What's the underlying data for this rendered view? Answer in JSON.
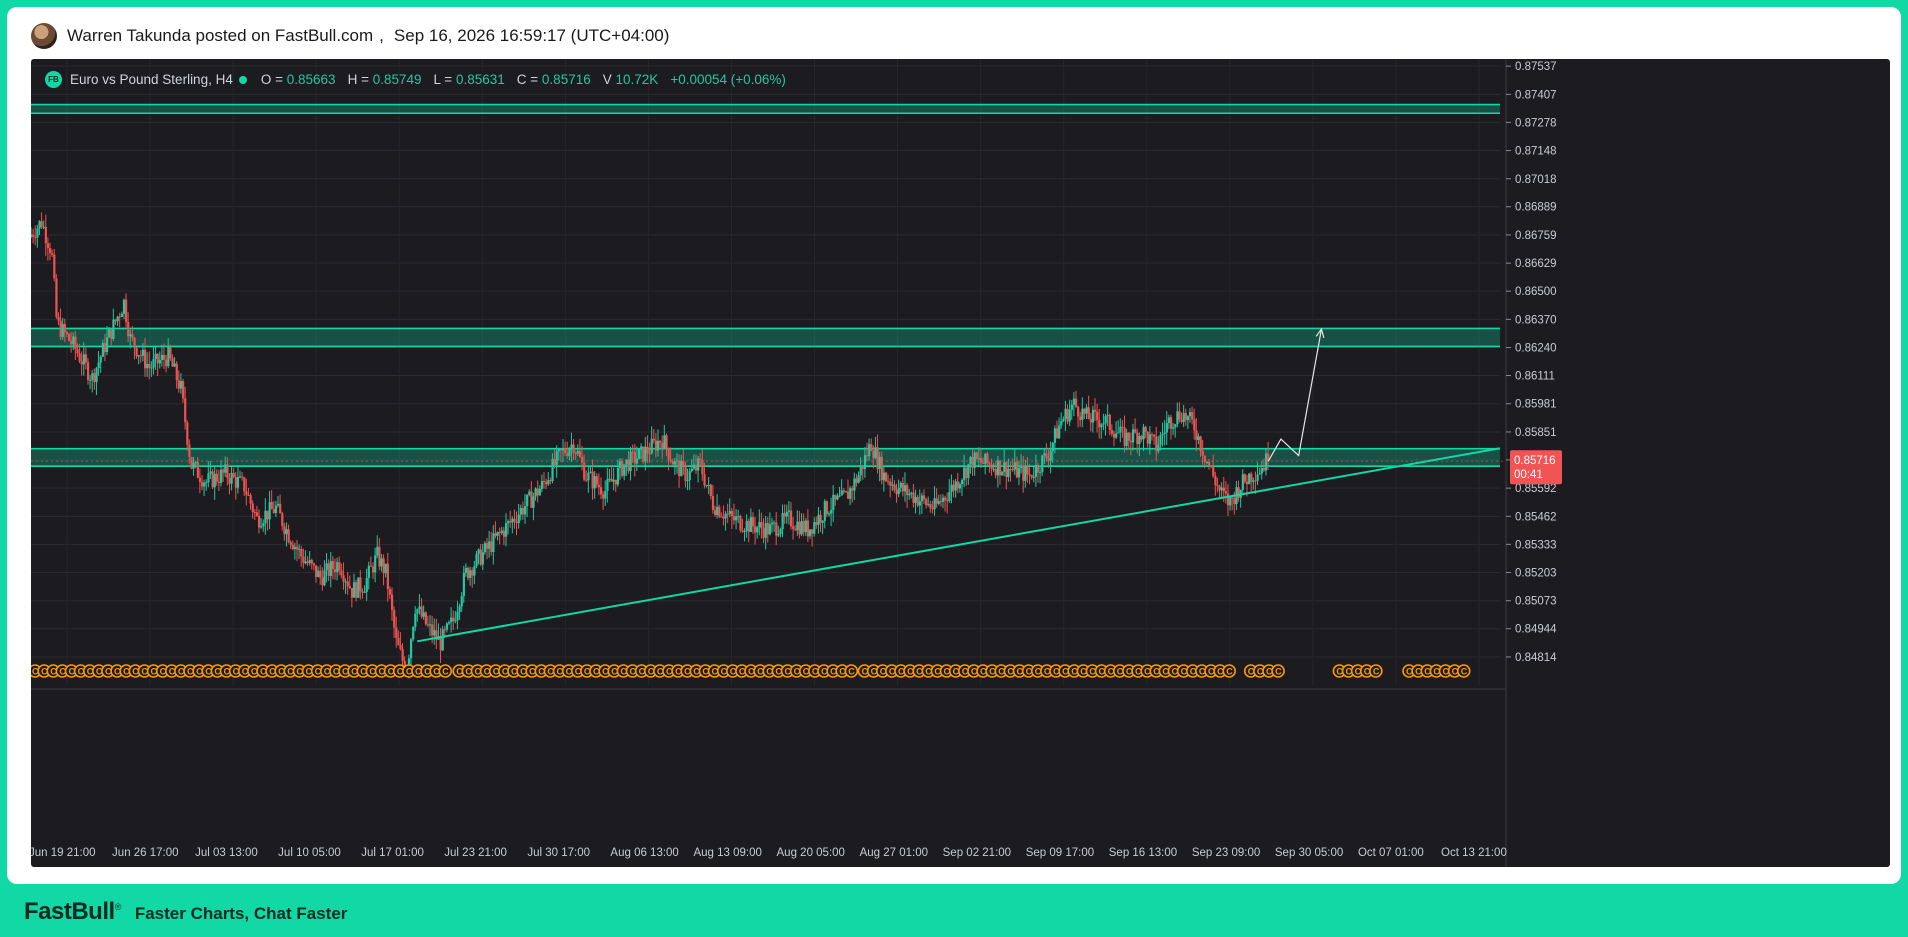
{
  "post": {
    "author_line": "Warren Takunda posted on FastBull.com",
    "separator": ",",
    "datetime": "Sep 16, 2026 16:59:17 (UTC+04:00)"
  },
  "legend": {
    "badge": "FB",
    "symbol": "Euro vs Pound Sterling, H4",
    "open_label": "O =",
    "open": "0.85663",
    "high_label": "H =",
    "high": "0.85749",
    "low_label": "L =",
    "low": "0.85631",
    "close_label": "C =",
    "close": "0.85716",
    "volume_label": "V",
    "volume": "10.72K",
    "change": "+0.00054 (+0.06%)"
  },
  "price_tag": {
    "price": "0.85716",
    "countdown": "00:41"
  },
  "footer": {
    "brand": "FastBull",
    "trademark": "®",
    "tagline": "Faster Charts, Chat Faster"
  },
  "colors": {
    "up": "#26c6a0",
    "down": "#ef5350",
    "zone": "#11d8a5",
    "event": "#ff9800",
    "background": "#1c1c20"
  },
  "chart_data": {
    "type": "candlestick",
    "timeframe": "H4",
    "ylim": [
      0.8468,
      0.8757
    ],
    "y_ticks": [
      "0.87537",
      "0.87407",
      "0.87278",
      "0.87148",
      "0.87018",
      "0.86889",
      "0.86759",
      "0.86629",
      "0.86500",
      "0.86370",
      "0.86240",
      "0.86111",
      "0.85981",
      "0.85851",
      "0.85722",
      "0.85592",
      "0.85462",
      "0.85333",
      "0.85203",
      "0.85073",
      "0.84944",
      "0.84814"
    ],
    "x_ticks": [
      "Jun 19 21:00",
      "Jun 26 17:00",
      "Jul 03 13:00",
      "Jul 10 05:00",
      "Jul 17 01:00",
      "Jul 23 21:00",
      "Jul 30 17:00",
      "Aug 06 13:00",
      "Aug 13 09:00",
      "Aug 20 05:00",
      "Aug 27 01:00",
      "Sep 02 21:00",
      "Sep 09 17:00",
      "Sep 16 13:00",
      "Sep 23 09:00",
      "Sep 30 05:00",
      "Oct 07 01:00",
      "Oct 13 21:00"
    ],
    "x_range_days": [
      0,
      116
    ],
    "last_price": 0.85716,
    "price_path": [
      {
        "t": 0.0,
        "p": 0.8675
      },
      {
        "t": 1.0,
        "p": 0.8682
      },
      {
        "t": 1.8,
        "p": 0.8668
      },
      {
        "t": 2.2,
        "p": 0.8635
      },
      {
        "t": 3.5,
        "p": 0.8625
      },
      {
        "t": 5.0,
        "p": 0.861
      },
      {
        "t": 6.0,
        "p": 0.8625
      },
      {
        "t": 7.5,
        "p": 0.8645
      },
      {
        "t": 8.0,
        "p": 0.8628
      },
      {
        "t": 9.5,
        "p": 0.8615
      },
      {
        "t": 11.0,
        "p": 0.862
      },
      {
        "t": 12.0,
        "p": 0.8605
      },
      {
        "t": 12.8,
        "p": 0.857
      },
      {
        "t": 14.0,
        "p": 0.8562
      },
      {
        "t": 15.5,
        "p": 0.8566
      },
      {
        "t": 17.0,
        "p": 0.856
      },
      {
        "t": 18.0,
        "p": 0.8545
      },
      {
        "t": 19.5,
        "p": 0.855
      },
      {
        "t": 20.5,
        "p": 0.8538
      },
      {
        "t": 21.5,
        "p": 0.8528
      },
      {
        "t": 23.0,
        "p": 0.8518
      },
      {
        "t": 24.5,
        "p": 0.8525
      },
      {
        "t": 25.5,
        "p": 0.8512
      },
      {
        "t": 26.5,
        "p": 0.8515
      },
      {
        "t": 27.5,
        "p": 0.8528
      },
      {
        "t": 28.2,
        "p": 0.852
      },
      {
        "t": 29.0,
        "p": 0.8488
      },
      {
        "t": 29.8,
        "p": 0.8475
      },
      {
        "t": 30.5,
        "p": 0.8505
      },
      {
        "t": 31.5,
        "p": 0.8495
      },
      {
        "t": 32.5,
        "p": 0.8488
      },
      {
        "t": 33.5,
        "p": 0.8498
      },
      {
        "t": 34.5,
        "p": 0.852
      },
      {
        "t": 36.0,
        "p": 0.853
      },
      {
        "t": 37.5,
        "p": 0.854
      },
      {
        "t": 39.0,
        "p": 0.855
      },
      {
        "t": 40.5,
        "p": 0.856
      },
      {
        "t": 42.0,
        "p": 0.8575
      },
      {
        "t": 43.0,
        "p": 0.858
      },
      {
        "t": 44.0,
        "p": 0.8565
      },
      {
        "t": 45.5,
        "p": 0.8558
      },
      {
        "t": 47.0,
        "p": 0.857
      },
      {
        "t": 48.5,
        "p": 0.8575
      },
      {
        "t": 50.0,
        "p": 0.8582
      },
      {
        "t": 51.0,
        "p": 0.857
      },
      {
        "t": 52.0,
        "p": 0.8565
      },
      {
        "t": 53.0,
        "p": 0.857
      },
      {
        "t": 54.0,
        "p": 0.8552
      },
      {
        "t": 55.5,
        "p": 0.8545
      },
      {
        "t": 57.0,
        "p": 0.8542
      },
      {
        "t": 58.5,
        "p": 0.854
      },
      {
        "t": 60.0,
        "p": 0.8545
      },
      {
        "t": 61.5,
        "p": 0.854
      },
      {
        "t": 63.0,
        "p": 0.855
      },
      {
        "t": 64.5,
        "p": 0.8555
      },
      {
        "t": 65.5,
        "p": 0.8565
      },
      {
        "t": 66.5,
        "p": 0.858
      },
      {
        "t": 67.5,
        "p": 0.8565
      },
      {
        "t": 68.5,
        "p": 0.856
      },
      {
        "t": 70.0,
        "p": 0.8555
      },
      {
        "t": 71.5,
        "p": 0.855
      },
      {
        "t": 73.0,
        "p": 0.856
      },
      {
        "t": 74.5,
        "p": 0.8572
      },
      {
        "t": 76.0,
        "p": 0.857
      },
      {
        "t": 77.5,
        "p": 0.8568
      },
      {
        "t": 79.0,
        "p": 0.8565
      },
      {
        "t": 80.5,
        "p": 0.8575
      },
      {
        "t": 81.5,
        "p": 0.859
      },
      {
        "t": 82.5,
        "p": 0.8598
      },
      {
        "t": 83.5,
        "p": 0.8592
      },
      {
        "t": 85.0,
        "p": 0.859
      },
      {
        "t": 86.5,
        "p": 0.8582
      },
      {
        "t": 88.0,
        "p": 0.8585
      },
      {
        "t": 89.0,
        "p": 0.8578
      },
      {
        "t": 90.0,
        "p": 0.859
      },
      {
        "t": 91.0,
        "p": 0.8594
      },
      {
        "t": 92.0,
        "p": 0.8588
      },
      {
        "t": 93.0,
        "p": 0.8572
      },
      {
        "t": 94.0,
        "p": 0.8558
      },
      {
        "t": 94.8,
        "p": 0.8552
      },
      {
        "t": 95.6,
        "p": 0.856
      },
      {
        "t": 96.4,
        "p": 0.8565
      },
      {
        "t": 97.2,
        "p": 0.8568
      },
      {
        "t": 97.7,
        "p": 0.85716
      }
    ],
    "zones": [
      {
        "low": 0.8732,
        "high": 0.8736
      },
      {
        "low": 0.86245,
        "high": 0.86328
      },
      {
        "low": 0.85693,
        "high": 0.85774
      }
    ],
    "trendline": {
      "start": {
        "t": 30.5,
        "p": 0.84886
      },
      "end": {
        "t": 116.0,
        "p": 0.85776
      }
    },
    "projection": [
      {
        "t": 97.7,
        "p": 0.85716
      },
      {
        "t": 98.7,
        "p": 0.85818
      },
      {
        "t": 100.1,
        "p": 0.85742
      },
      {
        "t": 101.9,
        "p": 0.86325
      }
    ],
    "event_marker_label": "C"
  }
}
